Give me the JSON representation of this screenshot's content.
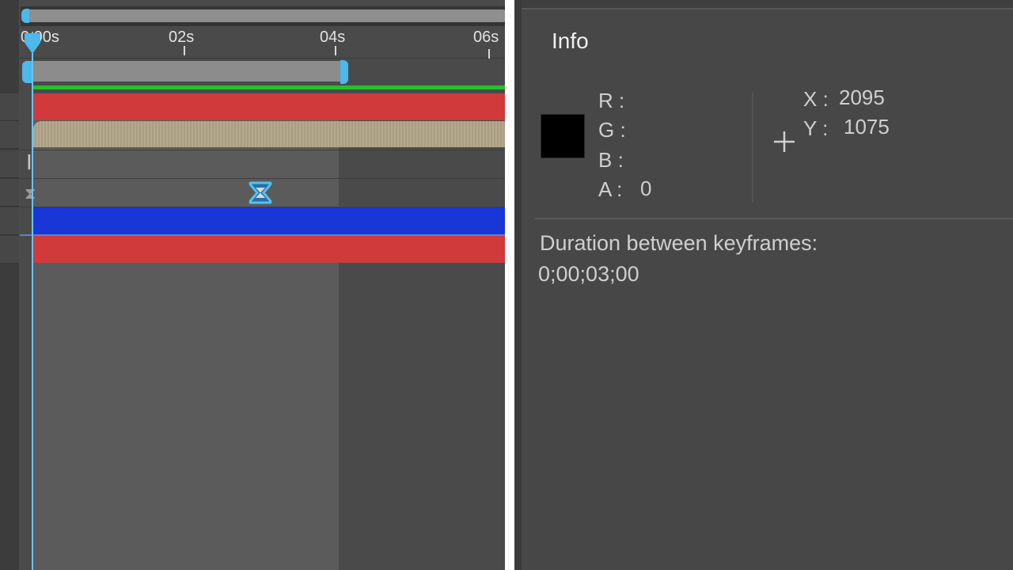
{
  "timeline": {
    "ruler_ticks": [
      {
        "label": "0:00s"
      },
      {
        "label": "02s"
      },
      {
        "label": "04s"
      },
      {
        "label": "06s"
      }
    ],
    "layer_colors": {
      "red": "#d03a3a",
      "tan": "#b0a387",
      "blue": "#1937d6",
      "green": "#22c22a",
      "accent": "#4cb8ec"
    }
  },
  "info": {
    "title": "Info",
    "swatch_color": "#000000",
    "channels": {
      "r_label": "R :",
      "g_label": "G :",
      "b_label": "B :",
      "a_label": "A :",
      "a_value": "0"
    },
    "coords": {
      "x_label": "X :",
      "x_value": "2095",
      "y_label": "Y :",
      "y_value": "1075"
    },
    "duration_label": "Duration between keyframes:",
    "duration_value": "0;00;03;00"
  }
}
